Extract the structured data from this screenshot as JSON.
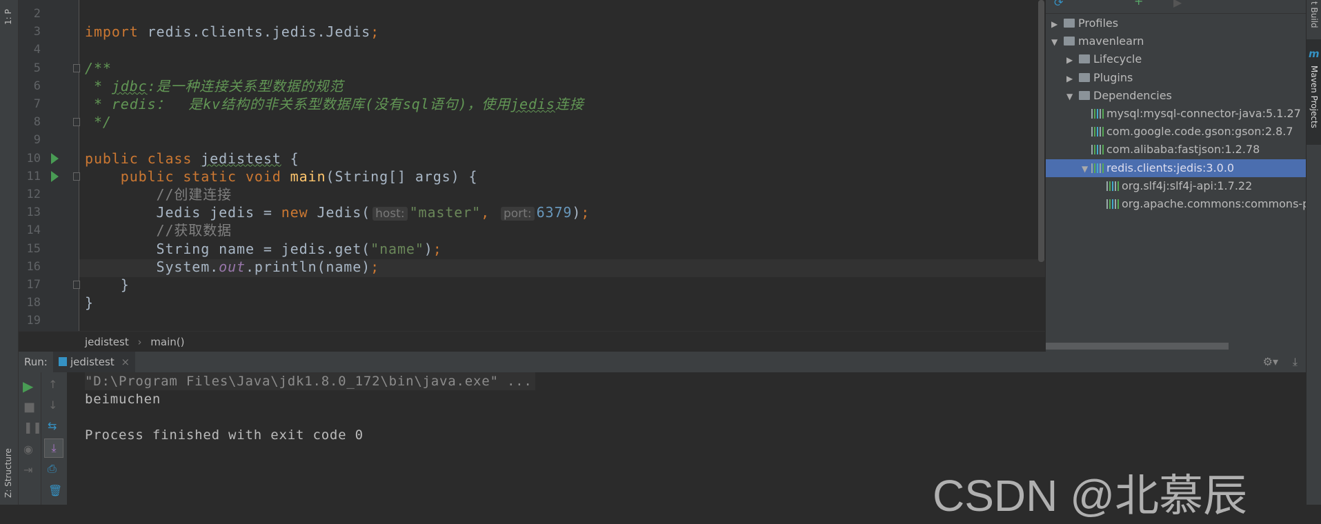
{
  "left_strip": {
    "project_tab": "1: P",
    "structure_tab": "Z: Structure"
  },
  "editor": {
    "first_line": 2,
    "lines": [
      [],
      [
        [
          "import",
          "kw"
        ],
        [
          " redis.clients.jedis.Jedis",
          ""
        ],
        [
          ";",
          "kw"
        ]
      ],
      [],
      [
        [
          "/**",
          "doc"
        ]
      ],
      [
        [
          " * ",
          "doc"
        ],
        [
          "jdbc",
          "doc squig"
        ],
        [
          ":是一种连接关系型数据的规范",
          "doc"
        ]
      ],
      [
        [
          " * redis：  是kv结构的非关系型数据库(没有sql语句)，使用",
          "doc"
        ],
        [
          "jedis",
          "doc squig"
        ],
        [
          "连接",
          "doc"
        ]
      ],
      [
        [
          " */",
          "doc"
        ]
      ],
      [],
      [
        [
          "public class ",
          "kw"
        ],
        [
          "jedistest",
          "squig"
        ],
        [
          " {",
          ""
        ]
      ],
      [
        [
          "    public static void ",
          "kw"
        ],
        [
          "main",
          "fn"
        ],
        [
          "(String[] args) {",
          ""
        ]
      ],
      [
        [
          "        //创建连接",
          "cm"
        ]
      ],
      [
        [
          "        Jedis jedis = ",
          ""
        ],
        [
          "new ",
          "kw"
        ],
        [
          "Jedis(",
          ""
        ],
        [
          "host:",
          "hint"
        ],
        [
          "\"master\"",
          "str"
        ],
        [
          ", ",
          "kw"
        ],
        [
          "port:",
          "hint"
        ],
        [
          "6379",
          "num"
        ],
        [
          ")",
          ""
        ],
        [
          ";",
          "kw"
        ]
      ],
      [
        [
          "        //获取数据",
          "cm"
        ]
      ],
      [
        [
          "        String name = jedis.get(",
          ""
        ],
        [
          "\"name\"",
          "str"
        ],
        [
          ")",
          ""
        ],
        [
          ";",
          "kw"
        ]
      ],
      [
        [
          "        System.",
          ""
        ],
        [
          "out",
          "fld"
        ],
        [
          ".println(name)",
          ""
        ],
        [
          ";",
          "kw"
        ]
      ],
      [
        [
          "    }",
          ""
        ]
      ],
      [
        [
          "}",
          ""
        ]
      ],
      []
    ],
    "run_markers": [
      10,
      11
    ],
    "fold_markers": [
      5,
      8,
      11,
      17
    ],
    "current_line": 16
  },
  "breadcrumb": {
    "items": [
      "jedistest",
      "main()"
    ],
    "separator": "›"
  },
  "maven": {
    "tree": [
      {
        "label": "Profiles",
        "level": 0,
        "arrow": "▶",
        "icon": "folder"
      },
      {
        "label": "mavenlearn",
        "level": 0,
        "arrow": "▼",
        "icon": "maven-module"
      },
      {
        "label": "Lifecycle",
        "level": 1,
        "arrow": "▶",
        "icon": "folder"
      },
      {
        "label": "Plugins",
        "level": 1,
        "arrow": "▶",
        "icon": "folder"
      },
      {
        "label": "Dependencies",
        "level": 1,
        "arrow": "▼",
        "icon": "folder"
      },
      {
        "label": "mysql:mysql-connector-java:5.1.27",
        "level": 2,
        "arrow": "",
        "icon": "library"
      },
      {
        "label": "com.google.code.gson:gson:2.8.7",
        "level": 2,
        "arrow": "",
        "icon": "library"
      },
      {
        "label": "com.alibaba:fastjson:1.2.78",
        "level": 2,
        "arrow": "",
        "icon": "library"
      },
      {
        "label": "redis.clients:jedis:3.0.0",
        "level": 2,
        "arrow": "▼",
        "icon": "library",
        "selected": true
      },
      {
        "label": "org.slf4j:slf4j-api:1.7.22",
        "level": 3,
        "arrow": "",
        "icon": "library"
      },
      {
        "label": "org.apache.commons:commons-p",
        "level": 3,
        "arrow": "",
        "icon": "library"
      }
    ]
  },
  "right_strip": {
    "build_tab": "t Build",
    "maven_tab": "Maven Projects"
  },
  "run": {
    "label": "Run:",
    "tab": "jedistest",
    "close": "×"
  },
  "console": {
    "lines": [
      "\"D:\\Program Files\\Java\\jdk1.8.0_172\\bin\\java.exe\" ...",
      "beimuchen",
      "",
      "Process finished with exit code 0"
    ]
  },
  "watermark": "CSDN @北慕辰",
  "colors": {
    "keyword": "#cc7832",
    "string": "#6a8759",
    "number": "#6897bb",
    "doc": "#629755",
    "selection": "#4b6eaf"
  }
}
